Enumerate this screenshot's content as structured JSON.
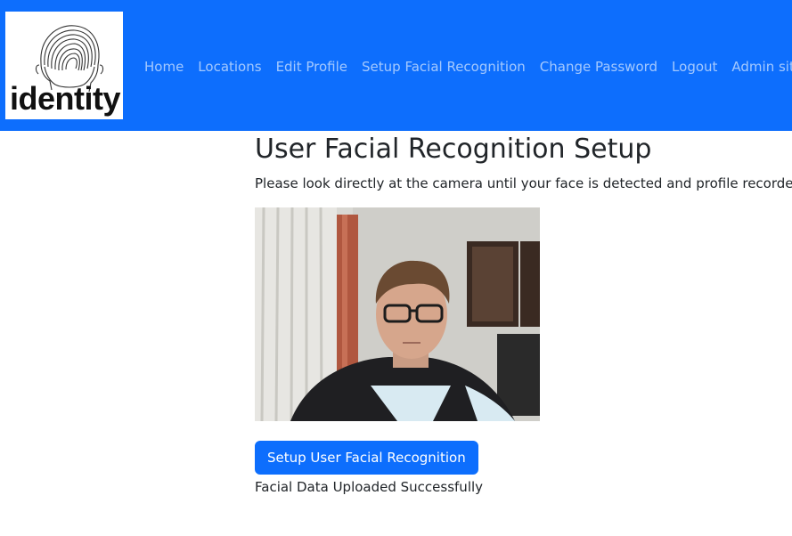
{
  "brand": {
    "logo_text": "identity"
  },
  "nav": {
    "items": [
      {
        "label": "Home"
      },
      {
        "label": "Locations"
      },
      {
        "label": "Edit Profile"
      },
      {
        "label": "Setup Facial Recognition"
      },
      {
        "label": "Change Password"
      },
      {
        "label": "Logout"
      },
      {
        "label": "Admin site"
      }
    ]
  },
  "main": {
    "title": "User Facial Recognition Setup",
    "instructions": "Please look directly at the camera until your face is detected and profile recorded.",
    "setup_button_label": "Setup User Facial Recognition",
    "status_text": "Facial Data Uploaded Successfully"
  },
  "colors": {
    "primary": "#0d6efd",
    "nav_text": "rgba(255,255,255,0.62)",
    "text": "#212529"
  },
  "icons": {
    "logo_image": "fingerprint-head-icon"
  }
}
